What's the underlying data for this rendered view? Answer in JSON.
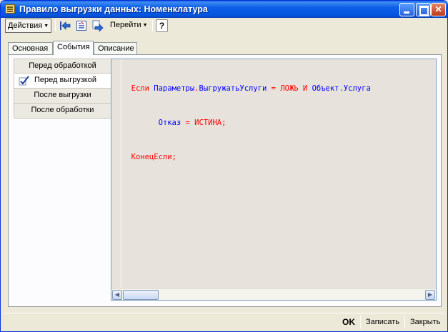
{
  "window": {
    "title": "Правило выгрузки данных: Номенклатура",
    "controls": {
      "minimize": "_",
      "maximize": "□",
      "close": "✕"
    }
  },
  "toolbar": {
    "actions_label": "Действия",
    "goto_label": "Перейти",
    "help_label": "?",
    "icons": [
      "back-arrow-icon",
      "list-icon",
      "forward-arrow-icon"
    ]
  },
  "tabs": [
    {
      "label": "Основная",
      "active": false
    },
    {
      "label": "События",
      "active": true
    },
    {
      "label": "Описание",
      "active": false
    }
  ],
  "events": [
    {
      "label": "Перед обработкой",
      "active": false
    },
    {
      "label": "Перед выгрузкой",
      "active": true
    },
    {
      "label": "После выгрузки",
      "active": false
    },
    {
      "label": "После обработки",
      "active": false
    }
  ],
  "code": {
    "line1": {
      "kw_if": "Если",
      "params": "Параметры",
      "dot1": ".",
      "export_services": "ВыгружатьУслуги",
      "eq": " = ",
      "false_kw": "ЛОЖЬ",
      "and_kw": " И ",
      "object": "Объект",
      "dot2": ".",
      "service": "Услуга"
    },
    "line2": {
      "refuse": "Отказ",
      "assign": " = ",
      "true_kw": "ИСТИНА",
      "semi": ";"
    },
    "line3": {
      "endif": "КонецЕсли",
      "semi": ";"
    }
  },
  "statusbar": {
    "ok_label": "OK",
    "save_label": "Записать",
    "close_label": "Закрыть"
  },
  "colors": {
    "titlebar": "#0454dc",
    "keyword": "#ff0000",
    "identifier": "#0000ff",
    "window_bg": "#ece9d8"
  }
}
